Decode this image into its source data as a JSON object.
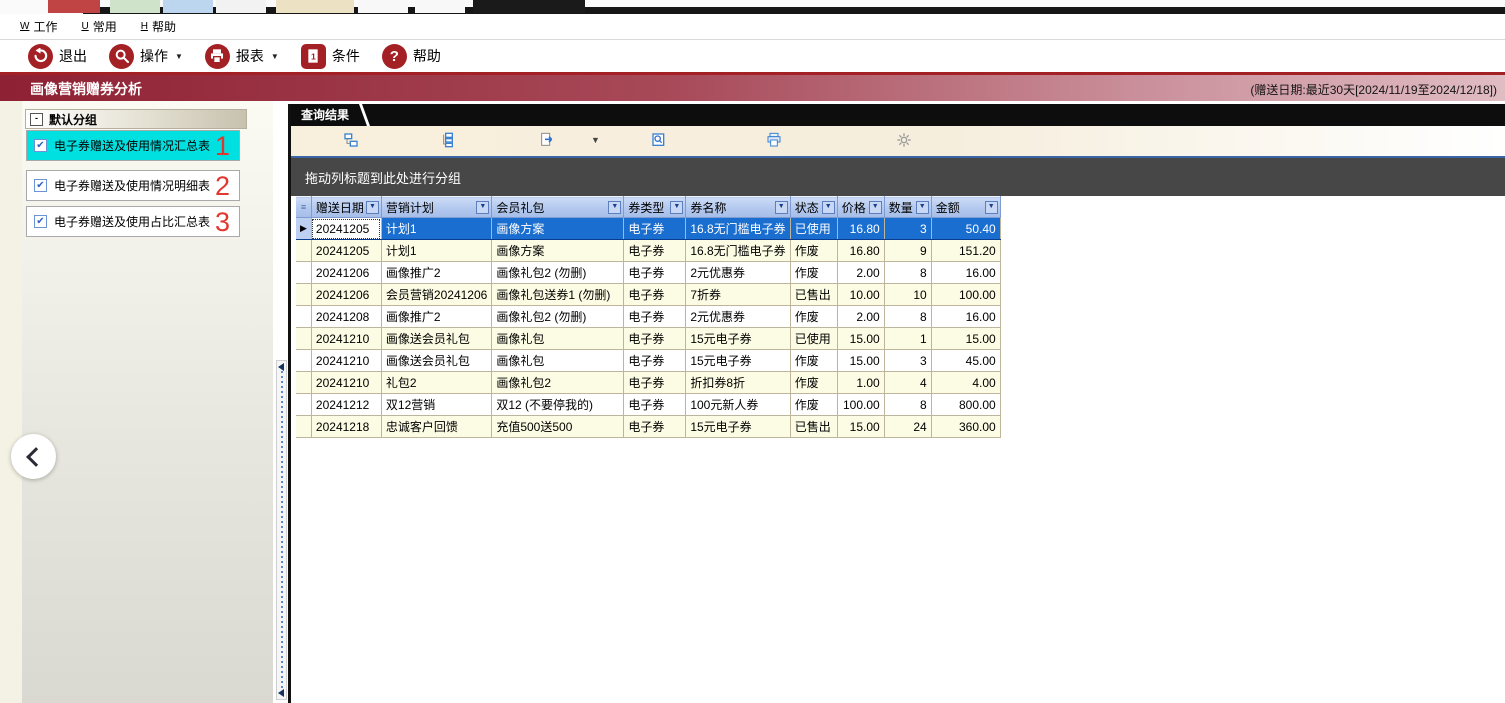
{
  "top_tabs": {
    "tabs": [
      {
        "name": "tab-stub-1",
        "color": "#c14444",
        "label": ""
      },
      {
        "name": "tab-stub-2",
        "color": "#cfe3cb",
        "label": ""
      },
      {
        "name": "tab-stub-3",
        "color": "#bcd6f0",
        "label": ""
      },
      {
        "name": "tab-stub-4",
        "color": "#f2f2f2",
        "label": ""
      },
      {
        "name": "tab-stub-5",
        "color": "#ece1c3",
        "label": ""
      },
      {
        "name": "tab-stub-6",
        "color": "#f8f8f8",
        "label": ""
      },
      {
        "name": "tab-stub-7",
        "color": "#f8f8f8",
        "label": ""
      },
      {
        "name": "tab-stub-active",
        "color": "#1a1a1a",
        "label": ""
      }
    ]
  },
  "menu_bar": {
    "items": [
      {
        "shortcut": "W",
        "label": "工作"
      },
      {
        "shortcut": "U",
        "label": "常用"
      },
      {
        "shortcut": "H",
        "label": "帮助"
      }
    ]
  },
  "toolbar": {
    "buttons": [
      {
        "label": "退出",
        "icon": "exit-undo-icon",
        "dropdown": false
      },
      {
        "label": "操作",
        "icon": "operate-magnifier-icon",
        "dropdown": true
      },
      {
        "label": "报表",
        "icon": "report-printer-icon",
        "dropdown": true
      },
      {
        "label": "条件",
        "icon": "criteria-icon",
        "dropdown": false
      },
      {
        "label": "帮助",
        "icon": "help-question-icon",
        "dropdown": false
      }
    ]
  },
  "title_bar": {
    "title": "画像营销赠券分析",
    "filter_info": "(赠送日期:最近30天[2024/11/19至2024/12/18])"
  },
  "sidebar": {
    "group_label": "默认分组",
    "collapse_glyph": "-",
    "items": [
      {
        "label": "电子券赠送及使用情况汇总表",
        "checked": true,
        "selected": true,
        "annotation": "1"
      },
      {
        "label": "电子券赠送及使用情况明细表",
        "checked": true,
        "selected": false,
        "annotation": "2"
      },
      {
        "label": "电子券赠送及使用占比汇总表",
        "checked": true,
        "selected": false,
        "annotation": "3"
      }
    ]
  },
  "grid": {
    "tab_label": "查询结果",
    "group_hint": "拖动列标题到此处进行分组",
    "toolbar_icons": [
      "collapse-groups-icon",
      "expand-groups-icon",
      "export-icon",
      "export-dropdown-arrow",
      "print-preview-icon",
      "print-icon",
      "settings-icon"
    ],
    "columns": [
      "赠送日期",
      "营销计划",
      "会员礼包",
      "券类型",
      "券名称",
      "状态",
      "价格",
      "数量",
      "金额"
    ],
    "rows": [
      {
        "selected": true,
        "cells": [
          "20241205",
          "计划1",
          "画像方案",
          "电子券",
          "16.8无门槛电子券",
          "已使用",
          "16.80",
          "3",
          "50.40"
        ]
      },
      {
        "selected": false,
        "cells": [
          "20241205",
          "计划1",
          "画像方案",
          "电子券",
          "16.8无门槛电子券",
          "作废",
          "16.80",
          "9",
          "151.20"
        ]
      },
      {
        "selected": false,
        "cells": [
          "20241206",
          "画像推广2",
          "画像礼包2 (勿删)",
          "电子券",
          "2元优惠券",
          "作废",
          "2.00",
          "8",
          "16.00"
        ]
      },
      {
        "selected": false,
        "cells": [
          "20241206",
          "会员营销20241206",
          "画像礼包送券1 (勿删)",
          "电子券",
          "7折券",
          "已售出",
          "10.00",
          "10",
          "100.00"
        ]
      },
      {
        "selected": false,
        "cells": [
          "20241208",
          "画像推广2",
          "画像礼包2 (勿删)",
          "电子券",
          "2元优惠券",
          "作废",
          "2.00",
          "8",
          "16.00"
        ]
      },
      {
        "selected": false,
        "cells": [
          "20241210",
          "画像送会员礼包",
          "画像礼包",
          "电子券",
          "15元电子券",
          "已使用",
          "15.00",
          "1",
          "15.00"
        ]
      },
      {
        "selected": false,
        "cells": [
          "20241210",
          "画像送会员礼包",
          "画像礼包",
          "电子券",
          "15元电子券",
          "作废",
          "15.00",
          "3",
          "45.00"
        ]
      },
      {
        "selected": false,
        "cells": [
          "20241210",
          "礼包2",
          "画像礼包2",
          "电子券",
          "折扣券8折",
          "作废",
          "1.00",
          "4",
          "4.00"
        ]
      },
      {
        "selected": false,
        "cells": [
          "20241212",
          "双12营销",
          "双12 (不要停我的)",
          "电子券",
          "100元新人券",
          "作废",
          "100.00",
          "8",
          "800.00"
        ]
      },
      {
        "selected": false,
        "cells": [
          "20241218",
          "忠诚客户回馈",
          "充值500送500",
          "电子券",
          "15元电子券",
          "已售出",
          "15.00",
          "24",
          "360.00"
        ]
      }
    ]
  },
  "colors": {
    "accent_red": "#a32025",
    "title_gradient_start": "#8e2133",
    "title_gradient_end": "#e0bcc3",
    "selected_item_cyan": "#00e0e0",
    "selected_row_blue": "#1a6ed0",
    "header_blue": "#b3c8ee",
    "row_cream": "#fcfbe3",
    "groupbar_gray": "#474747",
    "annotation_red": "#e0382e"
  }
}
